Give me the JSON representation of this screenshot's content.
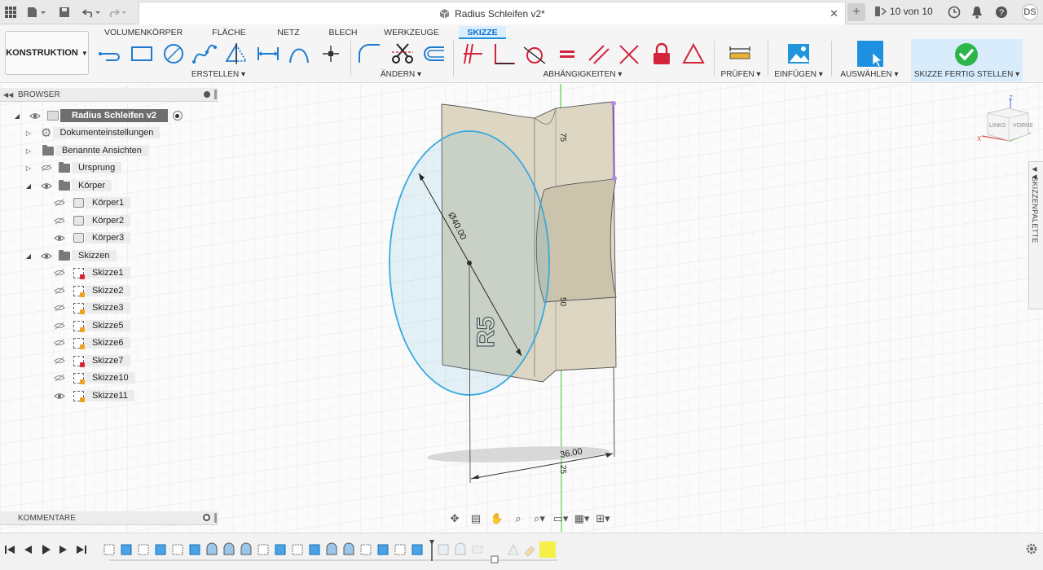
{
  "window": {
    "doc_title": "Radius Schleifen v2*",
    "jobs_text": "10 von 10",
    "user_initials": "DS"
  },
  "toolbar": {
    "workspace": "KONSTRUKTION",
    "tabs": [
      "VOLUMENKÖRPER",
      "FLÄCHE",
      "NETZ",
      "BLECH",
      "WERKZEUGE",
      "SKIZZE"
    ],
    "active_tab": "SKIZZE",
    "groups": [
      "ERSTELLEN",
      "ÄNDERN",
      "ABHÄNGIGKEITEN",
      "PRÜFEN",
      "EINFÜGEN",
      "AUSWÄHLEN",
      "SKIZZE FERTIG STELLEN"
    ]
  },
  "browser": {
    "title": "BROWSER",
    "root": "Radius Schleifen v2",
    "nodes": [
      "Dokumenteinstellungen",
      "Benannte Ansichten",
      "Ursprung",
      "Körper"
    ],
    "bodies": [
      "Körper1",
      "Körper2",
      "Körper3"
    ],
    "sketches_folder": "Skizzen",
    "sketches": [
      "Skizze1",
      "Skizze2",
      "Skizze3",
      "Skizze5",
      "Skizze6",
      "Skizze7",
      "Skizze10",
      "Skizze11"
    ]
  },
  "comments": {
    "title": "KOMMENTARE"
  },
  "palette": {
    "title": "SKIZZENPALETTE"
  },
  "viewcube": {
    "left": "LINKS",
    "front": "VORNE",
    "axis_z": "Z",
    "axis_x": "X"
  },
  "viewport": {
    "dim_diameter": "Ø40.00",
    "dim_36": "36.00",
    "dim_75": "75",
    "dim_50": "50",
    "dim_25": "25",
    "emboss_text": "R5"
  },
  "colors": {
    "accent": "#1f8fe0",
    "constraint": "#d3243c",
    "finish_check": "#2bb54b",
    "circle": "#39a9dd",
    "body_fill": "#ddd6c3"
  }
}
